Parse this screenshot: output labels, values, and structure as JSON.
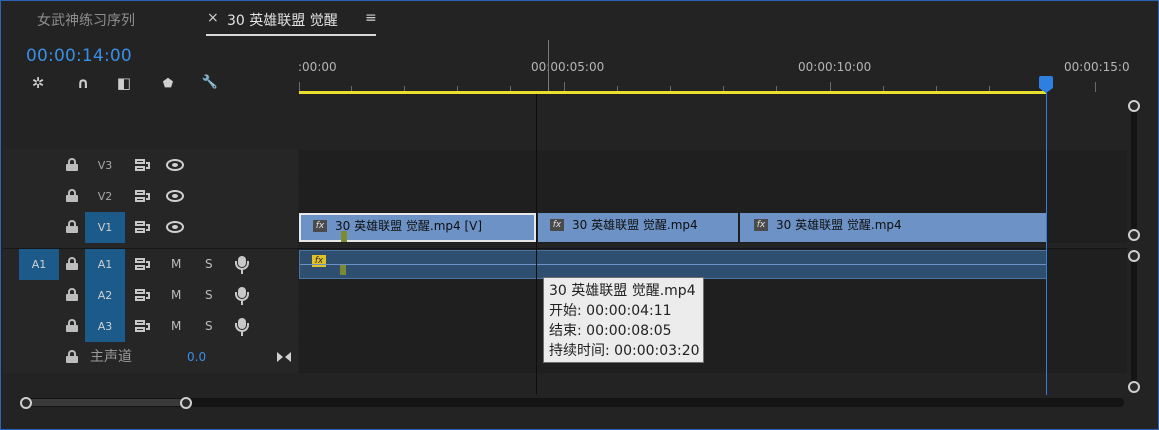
{
  "tabs": [
    {
      "label": "女武神练习序列",
      "active": false
    },
    {
      "label": "30 英雄联盟 觉醒",
      "active": true
    }
  ],
  "close_glyph": "×",
  "menu_glyph": "≡",
  "timecode": "00:00:14:00",
  "ruler": {
    "labels": [
      ":00:00",
      "00:00:05:00",
      "00:00:10:00",
      "00:00:15:0"
    ]
  },
  "tools": [
    {
      "icon": "snap-icon",
      "glyph": "✲"
    },
    {
      "icon": "linked-selection-icon",
      "glyph": "∩"
    },
    {
      "icon": "add-marker-icon",
      "glyph": "◧"
    },
    {
      "icon": "marker-icon",
      "glyph": "⬟"
    },
    {
      "icon": "wrench-icon",
      "glyph": "🔧"
    }
  ],
  "video_tracks": [
    {
      "name": "V3"
    },
    {
      "name": "V2"
    },
    {
      "name": "V1"
    }
  ],
  "audio_tracks": [
    {
      "name": "A1",
      "source": "A1",
      "mute": "M",
      "solo": "S"
    },
    {
      "name": "A2",
      "mute": "M",
      "solo": "S"
    },
    {
      "name": "A3",
      "mute": "M",
      "solo": "S"
    }
  ],
  "master": {
    "label": "主声道",
    "value": "0.0"
  },
  "clips": [
    {
      "label": "30 英雄联盟 觉醒.mp4 [V]",
      "fx": "fx"
    },
    {
      "label": "30 英雄联盟 觉醒.mp4",
      "fx": "fx"
    },
    {
      "label": "30 英雄联盟 觉醒.mp4",
      "fx": "fx"
    }
  ],
  "audio_clip": {
    "fx": "fx"
  },
  "tooltip": {
    "title": "30 英雄联盟 觉醒.mp4",
    "start": "开始: 00:00:04:11",
    "end": "结束: 00:00:08:05",
    "duration": "持续时间: 00:00:03:20"
  },
  "colors": {
    "accent": "#3a8ee6",
    "clip": "#6d93c6",
    "workarea": "#e8e02a",
    "target": "#1c5a8a"
  }
}
